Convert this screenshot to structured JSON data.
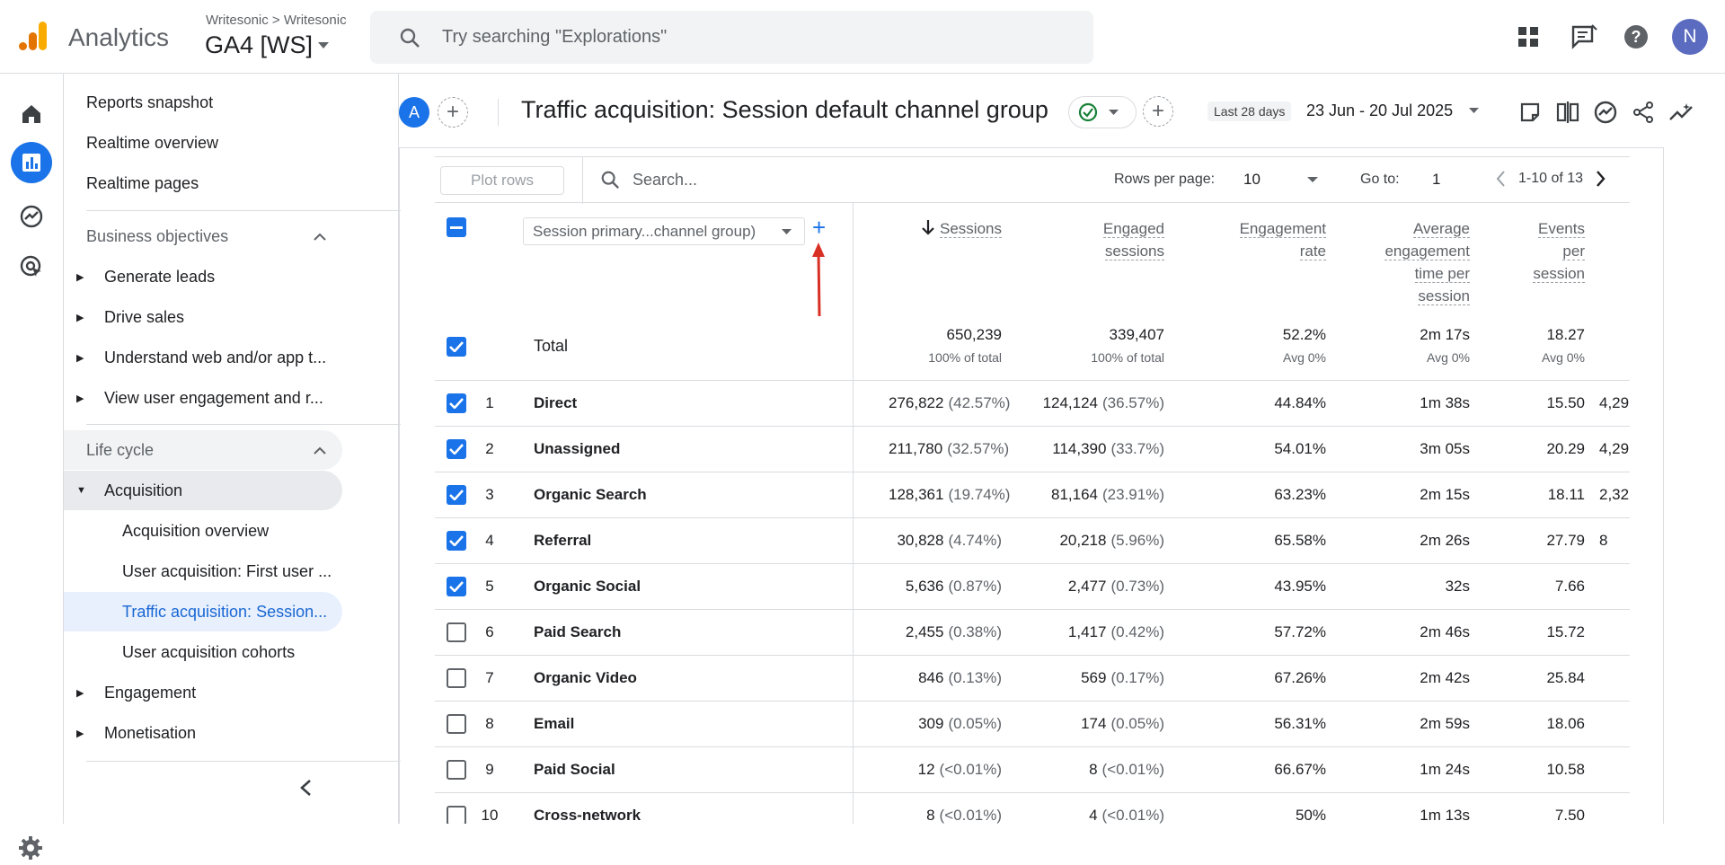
{
  "topbar": {
    "brand": "Analytics",
    "account_crumb": "Writesonic > Writesonic",
    "property_name": "GA4 [WS]",
    "search_placeholder": "Try searching \"Explorations\"",
    "user_initial": "N"
  },
  "nav": {
    "items": [
      {
        "label": "Reports snapshot"
      },
      {
        "label": "Realtime overview"
      },
      {
        "label": "Realtime pages"
      }
    ],
    "sections": [
      {
        "label": "Business objectives"
      },
      {
        "label": "Life cycle"
      }
    ],
    "business_items": [
      {
        "label": "Generate leads"
      },
      {
        "label": "Drive sales"
      },
      {
        "label": "Understand web and/or app t..."
      },
      {
        "label": "View user engagement and r..."
      }
    ],
    "lifecycle_items": [
      {
        "label": "Acquisition"
      },
      {
        "label": "Acquisition overview"
      },
      {
        "label": "User acquisition: First user ..."
      },
      {
        "label": "Traffic acquisition: Session..."
      },
      {
        "label": "User acquisition cohorts"
      },
      {
        "label": "Engagement"
      },
      {
        "label": "Monetisation"
      }
    ]
  },
  "header": {
    "comparison_avatar": "A",
    "title": "Traffic acquisition: Session default channel group",
    "date_badge": "Last 28 days",
    "date_range": "23 Jun - 20 Jul 2025"
  },
  "toolbar": {
    "plot_rows": "Plot rows",
    "search_placeholder": "Search...",
    "rows_per_page_label": "Rows per page:",
    "rows_per_page": "10",
    "goto_label": "Go to:",
    "goto_value": "1",
    "pagination": "1-10 of 13"
  },
  "table": {
    "dimension_select": "Session primary...channel group)",
    "headers": {
      "sessions": "Sessions",
      "engaged_1": "Engaged",
      "engaged_2": "sessions",
      "rate_1": "Engagement",
      "rate_2": "rate",
      "avg_1": "Average",
      "avg_2": "engagement",
      "avg_3": "time per",
      "avg_4": "session",
      "ev_1": "Events",
      "ev_2": "per",
      "ev_3": "session"
    },
    "total": {
      "label": "Total",
      "sessions": "650,239",
      "sessions_sub": "100% of total",
      "engaged": "339,407",
      "engaged_sub": "100% of total",
      "rate": "52.2%",
      "rate_sub": "Avg 0%",
      "avg_time": "2m 17s",
      "avg_time_sub": "Avg 0%",
      "events": "18.27",
      "events_sub": "Avg 0%"
    },
    "rows": [
      {
        "num": "1",
        "name": "Direct",
        "checked": true,
        "sessions": "276,822",
        "sessions_pct": "(42.57%)",
        "engaged": "124,124",
        "engaged_pct": "(36.57%)",
        "rate": "44.84%",
        "avg_time": "1m 38s",
        "events": "15.50",
        "extra": "4,29"
      },
      {
        "num": "2",
        "name": "Unassigned",
        "checked": true,
        "sessions": "211,780",
        "sessions_pct": "(32.57%)",
        "engaged": "114,390",
        "engaged_pct": "(33.7%)",
        "rate": "54.01%",
        "avg_time": "3m 05s",
        "events": "20.29",
        "extra": "4,29"
      },
      {
        "num": "3",
        "name": "Organic Search",
        "checked": true,
        "sessions": "128,361",
        "sessions_pct": "(19.74%)",
        "engaged": "81,164",
        "engaged_pct": "(23.91%)",
        "rate": "63.23%",
        "avg_time": "2m 15s",
        "events": "18.11",
        "extra": "2,32"
      },
      {
        "num": "4",
        "name": "Referral",
        "checked": true,
        "sessions": "30,828",
        "sessions_pct": "(4.74%)",
        "engaged": "20,218",
        "engaged_pct": "(5.96%)",
        "rate": "65.58%",
        "avg_time": "2m 26s",
        "events": "27.79",
        "extra": "8"
      },
      {
        "num": "5",
        "name": "Organic Social",
        "checked": true,
        "sessions": "5,636",
        "sessions_pct": "(0.87%)",
        "engaged": "2,477",
        "engaged_pct": "(0.73%)",
        "rate": "43.95%",
        "avg_time": "32s",
        "events": "7.66",
        "extra": ""
      },
      {
        "num": "6",
        "name": "Paid Search",
        "checked": false,
        "sessions": "2,455",
        "sessions_pct": "(0.38%)",
        "engaged": "1,417",
        "engaged_pct": "(0.42%)",
        "rate": "57.72%",
        "avg_time": "2m 46s",
        "events": "15.72",
        "extra": ""
      },
      {
        "num": "7",
        "name": "Organic Video",
        "checked": false,
        "sessions": "846",
        "sessions_pct": "(0.13%)",
        "engaged": "569",
        "engaged_pct": "(0.17%)",
        "rate": "67.26%",
        "avg_time": "2m 42s",
        "events": "25.84",
        "extra": ""
      },
      {
        "num": "8",
        "name": "Email",
        "checked": false,
        "sessions": "309",
        "sessions_pct": "(0.05%)",
        "engaged": "174",
        "engaged_pct": "(0.05%)",
        "rate": "56.31%",
        "avg_time": "2m 59s",
        "events": "18.06",
        "extra": ""
      },
      {
        "num": "9",
        "name": "Paid Social",
        "checked": false,
        "sessions": "12",
        "sessions_pct": "(<0.01%)",
        "engaged": "8",
        "engaged_pct": "(<0.01%)",
        "rate": "66.67%",
        "avg_time": "1m 24s",
        "events": "10.58",
        "extra": ""
      },
      {
        "num": "10",
        "name": "Cross-network",
        "checked": false,
        "sessions": "8",
        "sessions_pct": "(<0.01%)",
        "engaged": "4",
        "engaged_pct": "(<0.01%)",
        "rate": "50%",
        "avg_time": "1m 13s",
        "events": "7.50",
        "extra": ""
      }
    ]
  },
  "colors": {
    "accent": "#1a73e8",
    "brand_orange": "#f9ab00",
    "arrow_red": "#d93025"
  }
}
